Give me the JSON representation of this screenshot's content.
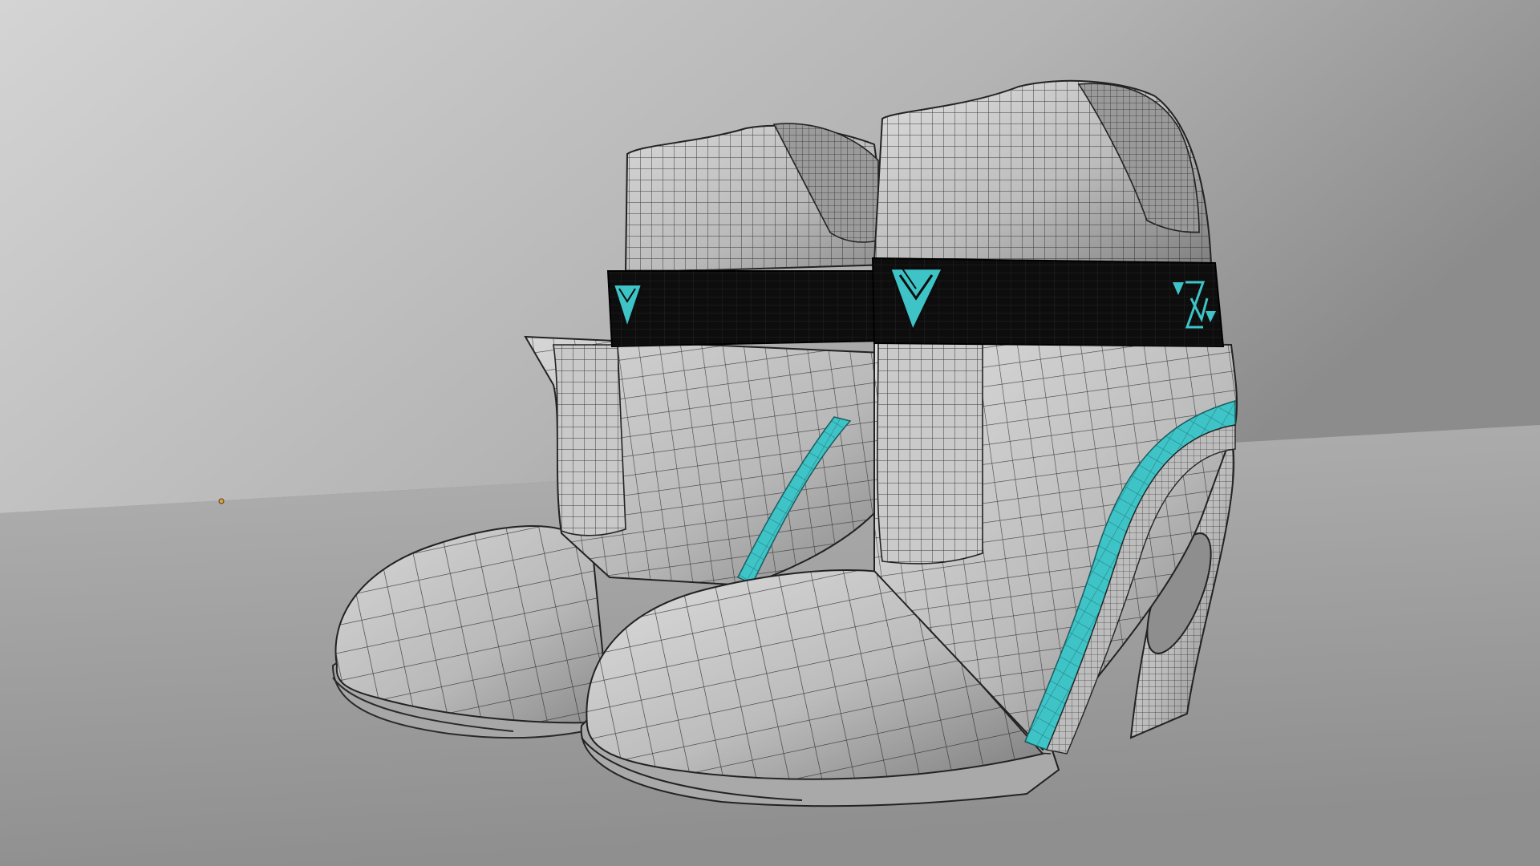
{
  "viewport": {
    "mode": "wireframe-over-solid",
    "background_colors": {
      "wall_light": "#d2d2d2",
      "wall_dark": "#8f8f8f",
      "floor_light": "#b5b5b5",
      "floor_dark": "#8e8e8e"
    }
  },
  "model": {
    "object": "pair-of-high-top-wedge-sneakers",
    "colors": {
      "body": "#c8c8c8",
      "body_shadow": "#8d8d8d",
      "wire": "#2a2a2a",
      "strap": "#0d0d0d",
      "accent": "#3ec3c6",
      "sole": "#a9a9a9"
    },
    "shoes": [
      {
        "name": "left-shoe"
      },
      {
        "name": "right-shoe"
      }
    ],
    "icons": [
      "triangle-logo-icon",
      "triangle-logo-icon",
      "brand-monogram-icon"
    ]
  },
  "origin_marker": {
    "color": "#e0a040"
  }
}
